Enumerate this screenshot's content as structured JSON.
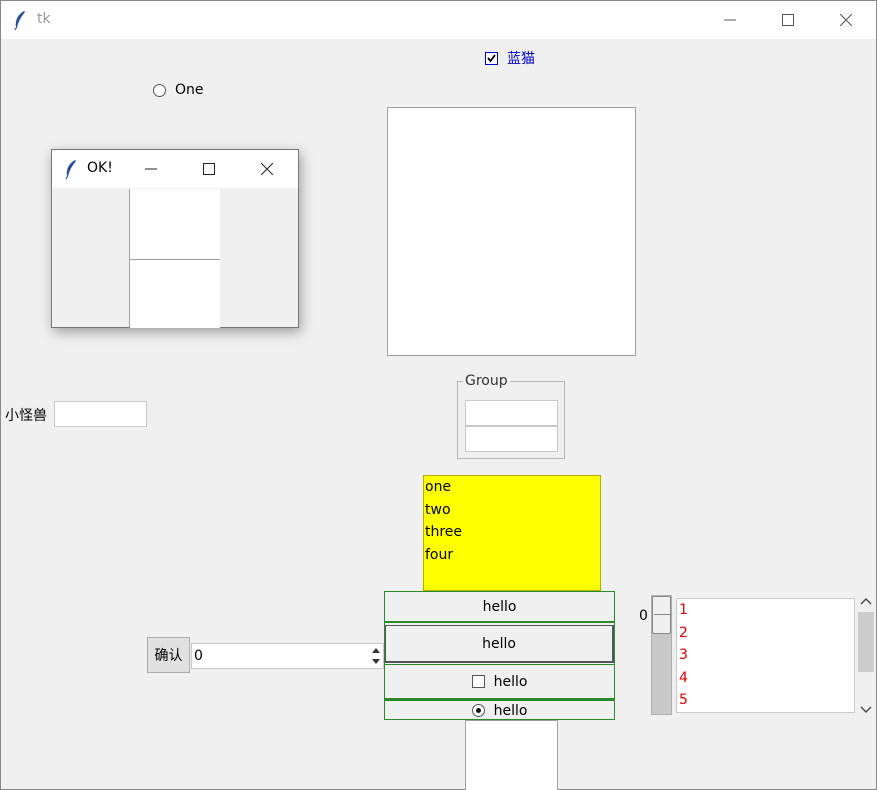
{
  "window": {
    "title": "tk"
  },
  "top_checkbox": {
    "label": "蓝猫",
    "checked": true,
    "color": "#0000cc"
  },
  "radio_one": {
    "label": "One",
    "selected": false
  },
  "popup": {
    "title": "OK!"
  },
  "entry_label": {
    "text": "小怪兽"
  },
  "group": {
    "label": "Group"
  },
  "listbox_yellow": {
    "items": [
      "one",
      "two",
      "three",
      "four"
    ],
    "bg": "#ffff00"
  },
  "confirm_button": {
    "label": "确认"
  },
  "spinbox": {
    "value": "0"
  },
  "hello_buttons": {
    "button1": "hello",
    "button2": "hello",
    "check_label": "hello",
    "radio_label": "hello"
  },
  "scale": {
    "value": "0"
  },
  "listbox_red": {
    "items": [
      "1",
      "2",
      "3",
      "4",
      "5"
    ],
    "color": "#e00000"
  }
}
